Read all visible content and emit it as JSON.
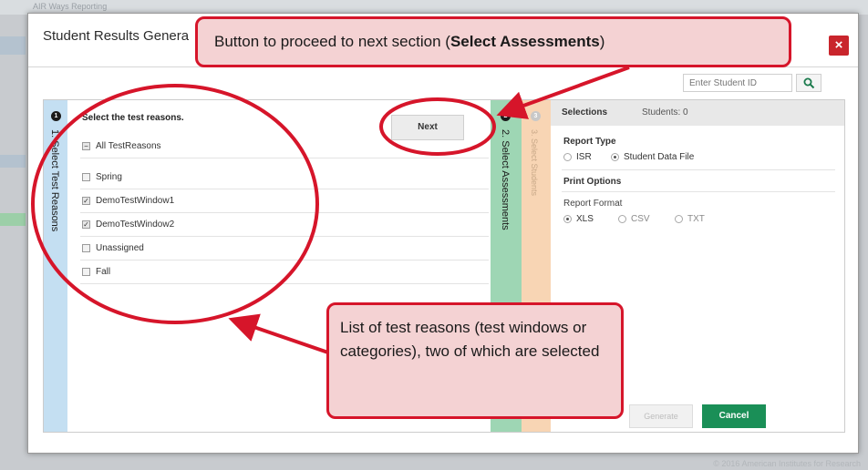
{
  "background": {
    "header_text": "AIR Ways Reporting",
    "copyright": "© 2016 American Institutes for Research"
  },
  "modal": {
    "title": "Student Results Genera",
    "close_glyph": "×",
    "student_id_placeholder": "Enter Student ID"
  },
  "steps": {
    "step1": {
      "label": "1. Select Test Reasons",
      "num": "1"
    },
    "step2": {
      "label": "2. Select Assessments",
      "num": "2"
    },
    "step3": {
      "label": "3. Select Students",
      "num": "3"
    }
  },
  "test_reasons": {
    "title": "Select the test reasons.",
    "next_label": "Next",
    "all_label": "All TestReasons",
    "items": [
      {
        "label": "Spring",
        "checked": false
      },
      {
        "label": "DemoTestWindow1",
        "checked": true
      },
      {
        "label": "DemoTestWindow2",
        "checked": true
      },
      {
        "label": "Unassigned",
        "checked": false
      },
      {
        "label": "Fall",
        "checked": false
      }
    ]
  },
  "selections": {
    "title": "Selections",
    "students": "Students: 0",
    "report_type_heading": "Report Type",
    "report_type_options": [
      "ISR",
      "Student Data File"
    ],
    "report_type_selected": "Student Data File",
    "print_options_heading": "Print Options",
    "report_format_label": "Report Format",
    "report_format_options": [
      "XLS",
      "CSV",
      "TXT"
    ],
    "report_format_selected": "XLS",
    "generate_label": "Generate",
    "cancel_label": "Cancel"
  },
  "callouts": {
    "top_prefix": "Button to proceed to next section (",
    "top_bold": "Select Assessments",
    "top_suffix": ")",
    "bottom_text": "List of test reasons (test windows or categories), two of which are selected"
  },
  "colors": {
    "annotation_red": "#d6152a",
    "callout_fill": "#f4d2d3",
    "step1_color": "#c4dff2",
    "step2_color": "#9ed6b4",
    "step3_color": "#f8d5b4",
    "cancel_green": "#1a8f57",
    "close_red": "#c9252c"
  }
}
